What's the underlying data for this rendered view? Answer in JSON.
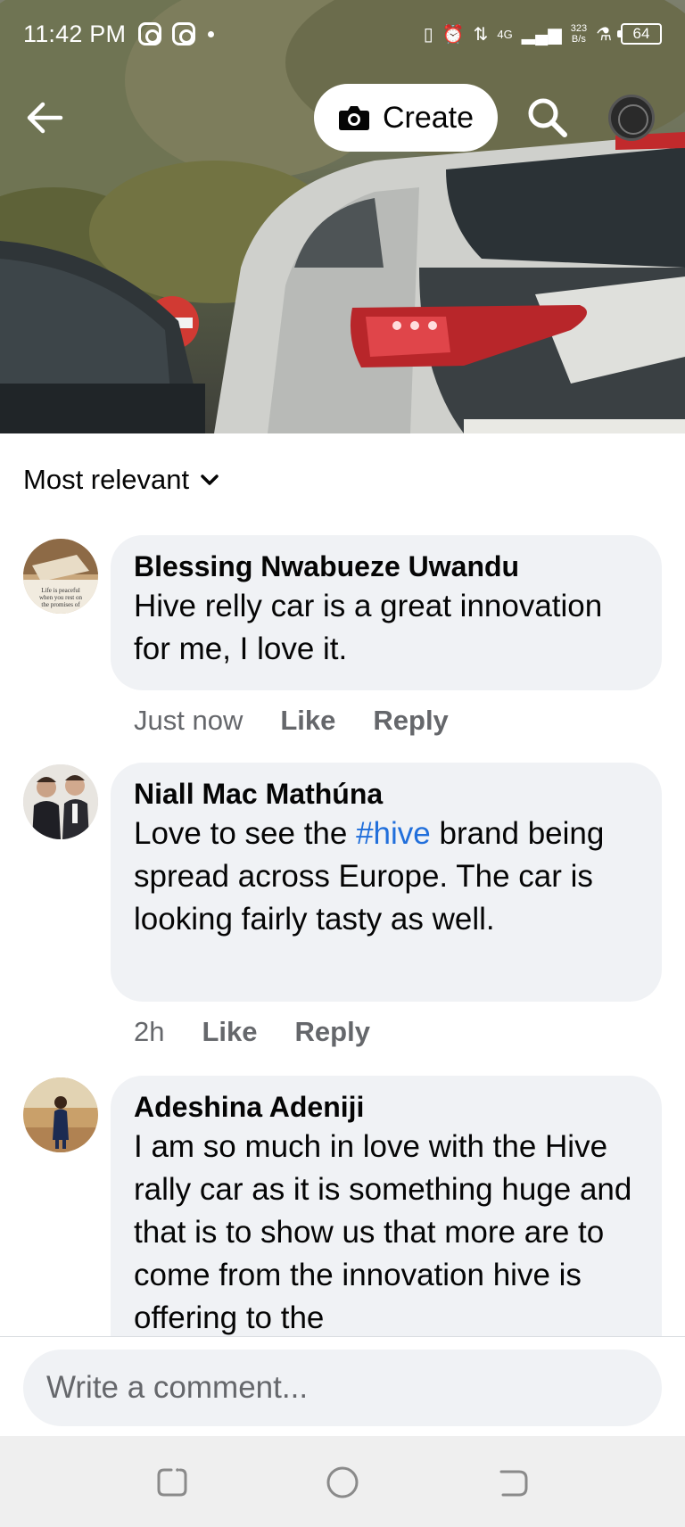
{
  "status_bar": {
    "time": "11:42 PM",
    "network": "4G",
    "speed_top": "323",
    "speed_bottom": "B/s",
    "battery": "64"
  },
  "header": {
    "create_label": "Create",
    "icons": [
      "back-arrow-icon",
      "camera-icon",
      "search-icon",
      "profile-avatar"
    ]
  },
  "sort": {
    "label": "Most relevant"
  },
  "comments": [
    {
      "author": "Blessing Nwabueze Uwandu",
      "text": "Hive relly car is a great innovation for me, I love it.",
      "time": "Just now",
      "like": "Like",
      "reply": "Reply"
    },
    {
      "author": "Niall Mac Mathúna",
      "text_before": "Love to see the ",
      "hashtag": "#hive",
      "text_after": " brand being spread across Europe. The car is looking fairly tasty as well.",
      "time": "2h",
      "like": "Like",
      "reply": "Reply"
    },
    {
      "author": "Adeshina Adeniji",
      "text": "I am so much in love with the Hive rally car as it is something huge and that is to show us that more are to come from the innovation hive is offering to the"
    }
  ],
  "avatar1_caption": "Life is peaceful when you rest on the promises of God's Word",
  "composer": {
    "placeholder": "Write a comment..."
  },
  "colors": {
    "bubble": "#f0f2f5",
    "meta_text": "#65676b",
    "hashtag": "#216fdb"
  }
}
